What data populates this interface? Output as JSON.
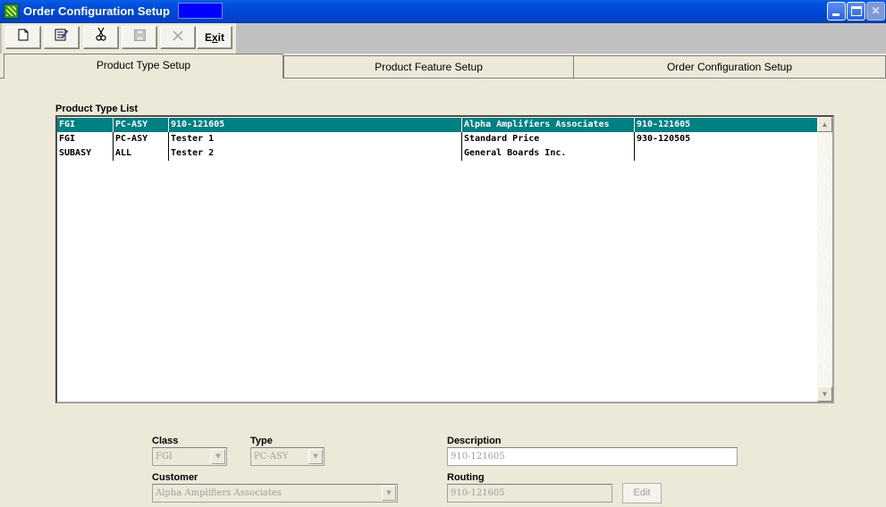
{
  "window": {
    "title": "Order Configuration Setup"
  },
  "toolbar": {
    "new_icon": "new-document-icon",
    "edit_icon": "edit-icon",
    "cut_icon": "scissors-icon",
    "save_icon": "save-icon",
    "delete_icon": "delete-x-icon",
    "exit_label": "Exit"
  },
  "tabs": [
    {
      "label": "Product Type Setup",
      "active": true
    },
    {
      "label": "Product Feature Setup",
      "active": false
    },
    {
      "label": "Order Configuration Setup",
      "active": false
    }
  ],
  "list": {
    "label": "Product Type List",
    "rows": [
      {
        "class": "FGI",
        "type": "PC-ASY",
        "description": "910-121605",
        "customer": "Alpha Amplifiers Associates",
        "routing": "910-121605",
        "selected": true
      },
      {
        "class": "FGI",
        "type": "PC-ASY",
        "description": "Tester 1",
        "customer": "Standard Price",
        "routing": "930-120505",
        "selected": false
      },
      {
        "class": "SUBASY",
        "type": "ALL",
        "description": "Tester 2",
        "customer": "General Boards Inc.",
        "routing": "",
        "selected": false
      }
    ]
  },
  "form": {
    "class_label": "Class",
    "class_value": "FGI",
    "type_label": "Type",
    "type_value": "PC-ASY",
    "description_label": "Description",
    "description_value": "910-121605",
    "customer_label": "Customer",
    "customer_value": "Alpha Amplifiers Associates",
    "routing_label": "Routing",
    "routing_value": "910-121605",
    "edit_label": "Edit"
  },
  "colors": {
    "titlebar": "#0048d5",
    "selection": "#008080",
    "title_box": "#0000ff"
  }
}
